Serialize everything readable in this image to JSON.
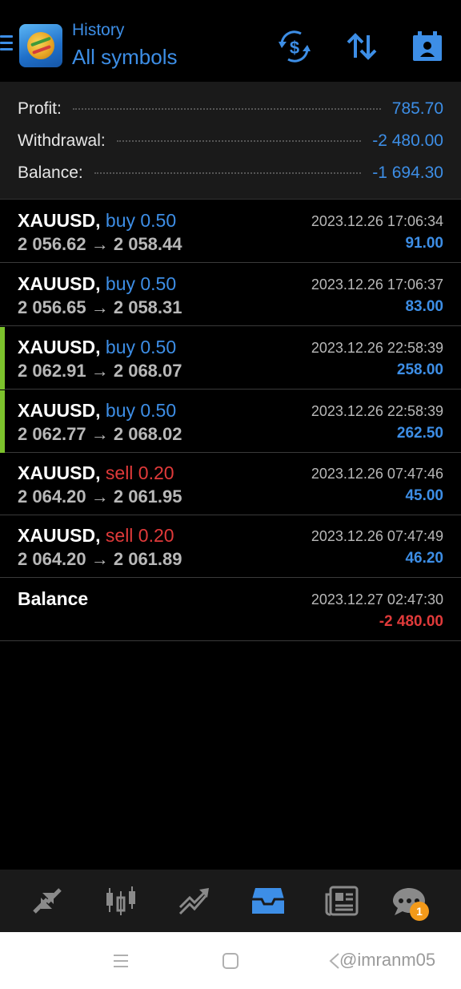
{
  "header": {
    "subtitle": "History",
    "title": "All symbols",
    "icons": [
      "menu-icon",
      "metatrader-logo",
      "currency-exchange-icon",
      "sort-icon",
      "calendar-icon"
    ]
  },
  "summary": [
    {
      "label": "Profit:",
      "value": "785.70"
    },
    {
      "label": "Withdrawal:",
      "value": "-2 480.00"
    },
    {
      "label": "Balance:",
      "value": "-1 694.30"
    }
  ],
  "deals": [
    {
      "symbol": "XAUUSD,",
      "type": "buy 0.50",
      "prices": "2 056.62 → 2 058.44",
      "time": "2023.12.26 17:06:34",
      "profit": "91.00"
    },
    {
      "symbol": "XAUUSD,",
      "type": "buy 0.50",
      "prices": "2 056.65 → 2 058.31",
      "time": "2023.12.26 17:06:37",
      "profit": "83.00"
    },
    {
      "symbol": "XAUUSD,",
      "type": "buy 0.50",
      "prices": "2 062.91 → 2 068.07",
      "time": "2023.12.26 22:58:39",
      "profit": "258.00"
    },
    {
      "symbol": "XAUUSD,",
      "type": "buy 0.50",
      "prices": "2 062.77 → 2 068.02",
      "time": "2023.12.26 22:58:39",
      "profit": "262.50"
    },
    {
      "symbol": "XAUUSD,",
      "type": "sell 0.20",
      "prices": "2 064.20 → 2 061.95",
      "time": "2023.12.26 07:47:46",
      "profit": "45.00"
    },
    {
      "symbol": "XAUUSD,",
      "type": "sell 0.20",
      "prices": "2 064.20 → 2 061.89",
      "time": "2023.12.26 07:47:49",
      "profit": "46.20"
    }
  ],
  "balance_entry": {
    "label": "Balance",
    "time": "2023.12.27 02:47:30",
    "profit": "-2 480.00"
  },
  "bottom_nav": {
    "items": [
      "quotes-icon",
      "chart-icon",
      "trade-icon",
      "history-icon",
      "news-icon",
      "messages-icon"
    ],
    "active": "history-icon",
    "messages_badge": "1"
  },
  "system_bar": {
    "watermark": "@imranm05"
  },
  "colors": {
    "accent": "#3d8ee6",
    "sell": "#e03a3a",
    "background": "#000000",
    "panel": "#1a1a1a",
    "marker": "#7cc22c",
    "badge": "#f39a1a"
  }
}
